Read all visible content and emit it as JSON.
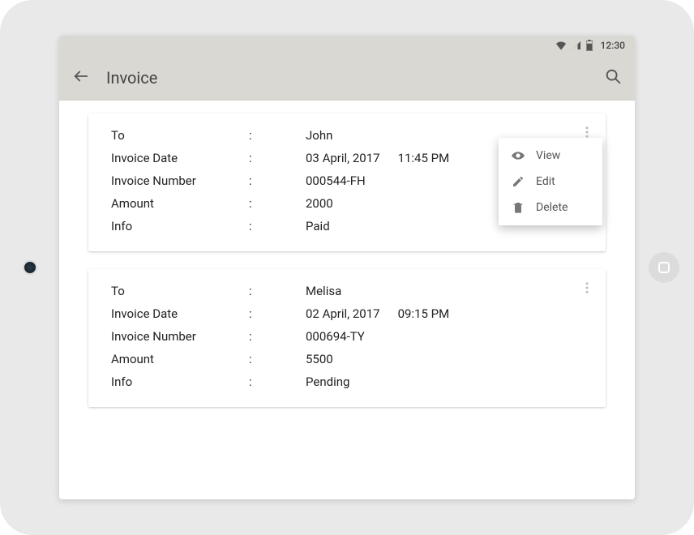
{
  "status": {
    "time": "12:30"
  },
  "appbar": {
    "title": "Invoice"
  },
  "labels": {
    "to": "To",
    "invoice_date": "Invoice Date",
    "invoice_number": "Invoice Number",
    "amount": "Amount",
    "info": "Info",
    "colon": ":"
  },
  "popup": {
    "view": "View",
    "edit": "Edit",
    "delete": "Delete"
  },
  "cards": [
    {
      "to": "John",
      "date": "03 April, 2017",
      "time": "11:45 PM",
      "number": "000544-FH",
      "amount": "2000",
      "info": "Paid",
      "showPopup": true
    },
    {
      "to": "Melisa",
      "date": "02 April, 2017",
      "time": "09:15 PM",
      "number": "000694-TY",
      "amount": "5500",
      "info": "Pending",
      "showPopup": false
    }
  ]
}
